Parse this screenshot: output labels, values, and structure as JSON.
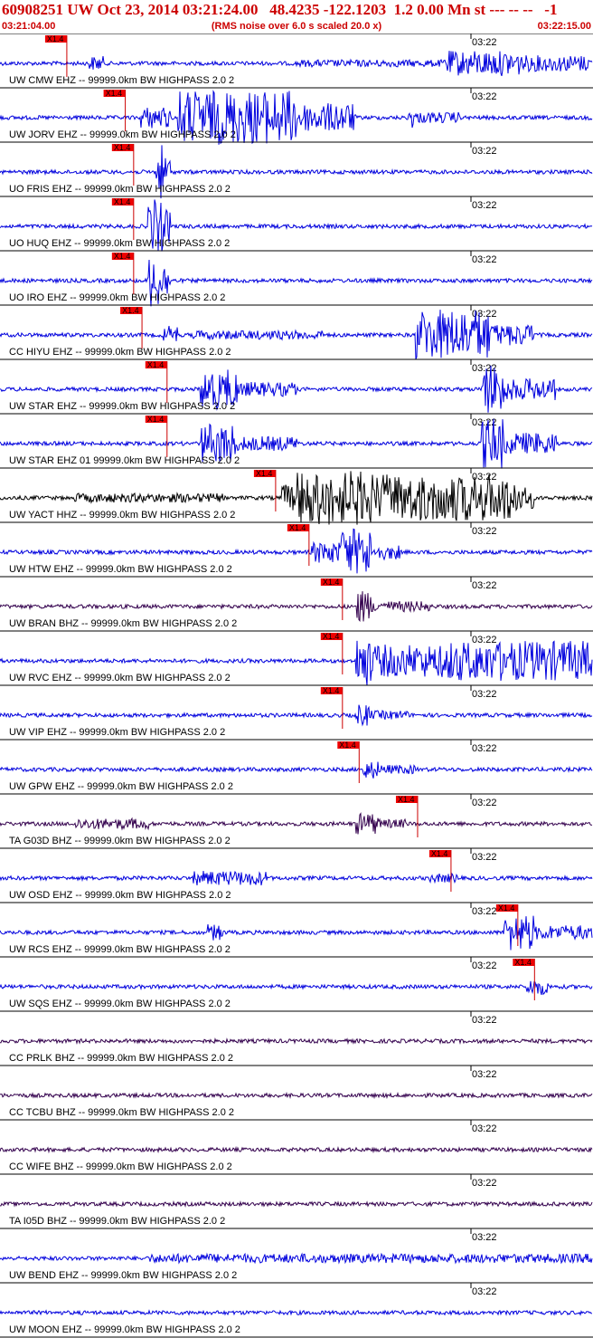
{
  "header": {
    "title": "60908251 UW Oct 23, 2014 03:21:24.00   48.4235 -122.1203  1.2 0.00 Mn st --- -- --   -1",
    "start_time": "03:21:04.00",
    "rms_note": "(RMS noise over 6.0 s scaled 20.0 x)",
    "end_time": "03:22:15.00"
  },
  "colors": {
    "title": "#cc0000",
    "trace_blue": "#0000dd",
    "trace_purple": "#33004d",
    "trace_black": "#000000",
    "pick_box": "#ee0000",
    "pick_line": "#cc0000",
    "axis": "#000000"
  },
  "chart_data": {
    "type": "line",
    "x_unit": "time",
    "time_start": "03:21:04.00",
    "time_end": "03:22:15.00",
    "minute_tick_label": "03:22",
    "pick_label": "X1.4",
    "series": [
      {
        "name": "UW CMW EHZ -- 99999.0km BW  HIGHPASS  2.0  2",
        "color": "blue",
        "pick": "03:21:12",
        "bursts": [
          [
            12,
            14,
            8
          ],
          [
            40,
            60,
            4
          ],
          [
            60,
            70,
            14
          ],
          [
            70,
            80,
            9
          ],
          [
            80,
            90,
            6
          ]
        ]
      },
      {
        "name": "UW JORV EHZ -- 99999.0km BW  HIGHPASS  2.0  2",
        "color": "blue",
        "pick": "03:21:19",
        "bursts": [
          [
            19,
            23,
            12
          ],
          [
            24,
            40,
            30
          ],
          [
            40,
            48,
            16
          ],
          [
            55,
            56,
            12
          ],
          [
            56,
            62,
            6
          ]
        ]
      },
      {
        "name": "UO FRIS EHZ -- 99999.0km BW  HIGHPASS  2.0  2",
        "color": "blue",
        "pick": "03:21:20",
        "bursts": [
          [
            21,
            22,
            30
          ],
          [
            22,
            23,
            18
          ]
        ]
      },
      {
        "name": "UO HUQ EHZ -- 99999.0km BW  HIGHPASS  2.0  2",
        "color": "blue",
        "pick": "03:21:20",
        "bursts": [
          [
            20,
            22,
            30
          ],
          [
            22,
            23,
            18
          ]
        ]
      },
      {
        "name": "UO IRO EHZ -- 99999.0km BW  HIGHPASS  2.0  2",
        "color": "blue",
        "pick": "03:21:20",
        "bursts": [
          [
            20,
            22,
            30
          ],
          [
            22,
            23,
            18
          ]
        ]
      },
      {
        "name": "CC HIYU EHZ -- 99999.0km BW  HIGHPASS  2.0  2",
        "color": "blue",
        "pick": "03:21:21",
        "bursts": [
          [
            22,
            24,
            10
          ],
          [
            26,
            44,
            5
          ],
          [
            56,
            66,
            28
          ],
          [
            66,
            72,
            12
          ]
        ]
      },
      {
        "name": "UW STAR EHZ -- 99999.0km BW  HIGHPASS  2.0  2",
        "color": "blue",
        "pick": "03:21:24",
        "bursts": [
          [
            27,
            32,
            22
          ],
          [
            32,
            40,
            8
          ],
          [
            65,
            68,
            28
          ],
          [
            68,
            75,
            12
          ]
        ]
      },
      {
        "name": "UW STAR EHZ 01 99999.0km BW  HIGHPASS  2.0  2",
        "color": "blue",
        "pick": "03:21:24",
        "bursts": [
          [
            27,
            32,
            22
          ],
          [
            32,
            40,
            8
          ],
          [
            65,
            68,
            28
          ],
          [
            68,
            75,
            12
          ]
        ]
      },
      {
        "name": "UW YACT HHZ -- 99999.0km BW  HIGHPASS  2.0  2",
        "color": "black",
        "pick": "03:21:37",
        "bursts": [
          [
            10,
            30,
            5
          ],
          [
            38,
            40,
            15
          ],
          [
            40,
            50,
            30
          ],
          [
            50,
            70,
            26
          ],
          [
            70,
            72,
            12
          ]
        ]
      },
      {
        "name": "UW HTW EHZ -- 99999.0km BW  HIGHPASS  2.0  2",
        "color": "blue",
        "pick": "03:21:41",
        "bursts": [
          [
            42,
            46,
            12
          ],
          [
            46,
            50,
            26
          ],
          [
            50,
            54,
            8
          ]
        ]
      },
      {
        "name": "UW BRAN BHZ -- 99999.0km BW  HIGHPASS  2.0  2",
        "color": "purple",
        "pick": "03:21:45",
        "bursts": [
          [
            48,
            50,
            18
          ],
          [
            50,
            58,
            6
          ]
        ]
      },
      {
        "name": "UW RVC EHZ -- 99999.0km BW  HIGHPASS  2.0  2",
        "color": "blue",
        "pick": "03:21:45",
        "bursts": [
          [
            48,
            50,
            28
          ],
          [
            50,
            60,
            18
          ],
          [
            60,
            80,
            22
          ]
        ]
      },
      {
        "name": "UW VIP EHZ -- 99999.0km BW  HIGHPASS  2.0  2",
        "color": "blue",
        "pick": "03:21:45",
        "bursts": [
          [
            48,
            50,
            12
          ],
          [
            50,
            55,
            5
          ]
        ]
      },
      {
        "name": "UW GPW EHZ -- 99999.0km BW  HIGHPASS  2.0  2",
        "color": "blue",
        "pick": "03:21:47",
        "bursts": [
          [
            49,
            51,
            10
          ],
          [
            51,
            56,
            5
          ]
        ]
      },
      {
        "name": "TA G03D BHZ -- 99999.0km BW  HIGHPASS  2.0  2",
        "color": "purple",
        "pick": "03:21:54",
        "bursts": [
          [
            10,
            20,
            6
          ],
          [
            48,
            51,
            12
          ],
          [
            51,
            55,
            5
          ]
        ]
      },
      {
        "name": "UW OSD EHZ -- 99999.0km BW  HIGHPASS  2.0  2",
        "color": "blue",
        "pick": "03:21:58",
        "bursts": [
          [
            26,
            36,
            8
          ],
          [
            58,
            62,
            5
          ]
        ]
      },
      {
        "name": "UW RCS EHZ -- 99999.0km BW  HIGHPASS  2.0  2",
        "color": "blue",
        "pick": "03:22:06",
        "bursts": [
          [
            28,
            30,
            9
          ],
          [
            68,
            72,
            20
          ],
          [
            72,
            80,
            8
          ]
        ]
      },
      {
        "name": "UW SQS EHZ -- 99999.0km BW  HIGHPASS  2.0  2",
        "color": "blue",
        "pick": "03:22:08",
        "bursts": [
          [
            71,
            74,
            9
          ]
        ]
      },
      {
        "name": "CC PRLK BHZ -- 99999.0km BW  HIGHPASS  2.0  2",
        "color": "purple",
        "pick": null,
        "bursts": []
      },
      {
        "name": "CC TCBU BHZ -- 99999.0km BW  HIGHPASS  2.0  2",
        "color": "purple",
        "pick": null,
        "bursts": []
      },
      {
        "name": "CC WIFE BHZ -- 99999.0km BW  HIGHPASS  2.0  2",
        "color": "purple",
        "pick": null,
        "bursts": []
      },
      {
        "name": "TA I05D BHZ -- 99999.0km BW  HIGHPASS  2.0  2",
        "color": "purple",
        "pick": null,
        "bursts": []
      },
      {
        "name": "UW BEND EHZ -- 99999.0km BW  HIGHPASS  2.0  2",
        "color": "blue",
        "pick": null,
        "bursts": [
          [
            20,
            80,
            5
          ]
        ]
      },
      {
        "name": "UW MOON EHZ -- 99999.0km BW  HIGHPASS  2.0  2",
        "color": "blue",
        "pick": null,
        "bursts": []
      }
    ]
  }
}
